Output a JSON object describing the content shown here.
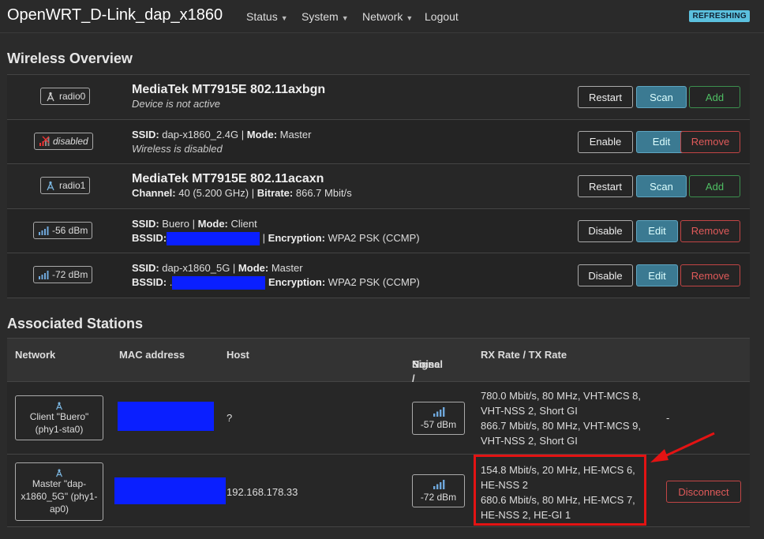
{
  "header": {
    "title": "OpenWRT_D-Link_dap_x1860",
    "nav": [
      "Status",
      "System",
      "Network"
    ],
    "logout": "Logout",
    "badge": "REFRESHING"
  },
  "wireless": {
    "title": "Wireless Overview",
    "rows": [
      {
        "chip": "radio0",
        "line1": "MediaTek MT7915E 802.11axbgn",
        "line2": "Device is not active",
        "buttons": [
          "Restart",
          "Scan",
          "Add"
        ]
      },
      {
        "chip": "disabled",
        "ssid_label": "SSID:",
        "ssid": "dap-x1860_2.4G",
        "mode_label": "Mode:",
        "mode": "Master",
        "line2": "Wireless is disabled",
        "buttons": [
          "Enable",
          "Edit",
          "Remove"
        ]
      },
      {
        "chip": "radio1",
        "line1": "MediaTek MT7915E 802.11acaxn",
        "channel_label": "Channel:",
        "channel": "40 (5.200 GHz)",
        "bitrate_label": "Bitrate:",
        "bitrate": "866.7 Mbit/s",
        "buttons": [
          "Restart",
          "Scan",
          "Add"
        ]
      },
      {
        "chip": "-56 dBm",
        "ssid_label": "SSID:",
        "ssid": "Buero",
        "mode_label": "Mode:",
        "mode": "Client",
        "bssid_label": "BSSID:",
        "enc_label": "Encryption:",
        "enc": "WPA2 PSK (CCMP)",
        "buttons": [
          "Disable",
          "Edit",
          "Remove"
        ]
      },
      {
        "chip": "-72 dBm",
        "ssid_label": "SSID:",
        "ssid": "dap-x1860_5G",
        "mode_label": "Mode:",
        "mode": "Master",
        "bssid_label": "BSSID:",
        "bssid_prefix": ".",
        "enc_label": "Encryption:",
        "enc": "WPA2 PSK (CCMP)",
        "buttons": [
          "Disable",
          "Edit",
          "Remove"
        ]
      }
    ]
  },
  "stations": {
    "title": "Associated Stations",
    "headers": [
      "Network",
      "MAC address",
      "Host",
      "Signal /",
      "Noise",
      "RX Rate / TX Rate"
    ],
    "rows": [
      {
        "net": [
          "Client \"Buero\"",
          "(phy1-sta0)"
        ],
        "host": "?",
        "signal": "-57 dBm",
        "rates": [
          "780.0 Mbit/s, 80 MHz, VHT-MCS 8,",
          "VHT-NSS 2, Short GI",
          "866.7 Mbit/s, 80 MHz, VHT-MCS 9,",
          "VHT-NSS 2, Short GI"
        ],
        "action": "-"
      },
      {
        "net": [
          "Master \"dap-",
          "x1860_5G\" (phy1-",
          "ap0)"
        ],
        "host": "192.168.178.33",
        "signal": "-72 dBm",
        "rates": [
          "154.8 Mbit/s, 20 MHz, HE-MCS 6,",
          "HE-NSS 2",
          "680.6 Mbit/s, 80 MHz, HE-MCS 7,",
          "HE-NSS 2, HE-GI 1"
        ],
        "action": "Disconnect"
      }
    ]
  }
}
